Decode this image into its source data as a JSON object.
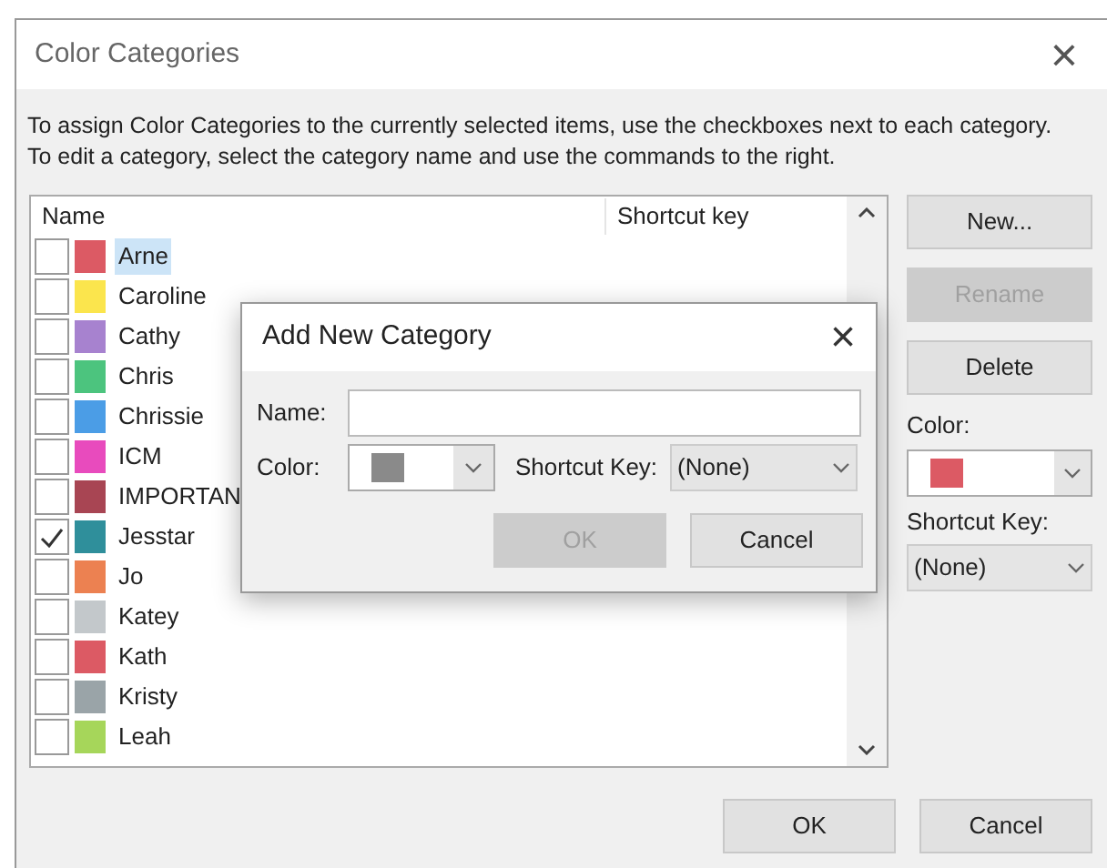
{
  "window": {
    "title": "Color Categories",
    "close": "×"
  },
  "instructions": [
    "To assign Color Categories to the currently selected items, use the checkboxes next to each category.",
    "To edit a category, select the category name and use the commands to the right."
  ],
  "list": {
    "columns": [
      "Name",
      "Shortcut key"
    ],
    "rows": [
      {
        "name": "Arne",
        "color": "#dc5a64",
        "checked": false,
        "selected": true
      },
      {
        "name": "Caroline",
        "color": "#fbe54d",
        "checked": false,
        "selected": false
      },
      {
        "name": "Cathy",
        "color": "#a782cf",
        "checked": false,
        "selected": false
      },
      {
        "name": "Chris",
        "color": "#4cc47e",
        "checked": false,
        "selected": false
      },
      {
        "name": "Chrissie",
        "color": "#4b9de6",
        "checked": false,
        "selected": false
      },
      {
        "name": "ICM",
        "color": "#e84bbd",
        "checked": false,
        "selected": false
      },
      {
        "name": "IMPORTAN",
        "color": "#a84553",
        "checked": false,
        "selected": false
      },
      {
        "name": "Jesstar",
        "color": "#2f8f9b",
        "checked": true,
        "selected": false
      },
      {
        "name": "Jo",
        "color": "#ec8151",
        "checked": false,
        "selected": false
      },
      {
        "name": "Katey",
        "color": "#c3c8cb",
        "checked": false,
        "selected": false
      },
      {
        "name": "Kath",
        "color": "#dc5a64",
        "checked": false,
        "selected": false
      },
      {
        "name": "Kristy",
        "color": "#9aa4a8",
        "checked": false,
        "selected": false
      },
      {
        "name": "Leah",
        "color": "#a6d65a",
        "checked": false,
        "selected": false
      }
    ]
  },
  "side": {
    "buttons": [
      {
        "label": "New...",
        "disabled": false
      },
      {
        "label": "Rename",
        "disabled": true
      },
      {
        "label": "Delete",
        "disabled": false
      }
    ],
    "color_label": "Color:",
    "color": "#dc5a64",
    "shortcut_label": "Shortcut Key:",
    "shortcut": "(None)"
  },
  "footer": {
    "buttons": [
      "OK",
      "Cancel"
    ]
  },
  "modal": {
    "title": "Add New Category",
    "close": "×",
    "name_label": "Name:",
    "color_label": "Color:",
    "color": "#8a8a8a",
    "shortcut_label": "Shortcut Key:",
    "shortcut": "(None)",
    "buttons": [
      {
        "label": "OK",
        "disabled": true
      },
      {
        "label": "Cancel",
        "disabled": false
      }
    ]
  }
}
